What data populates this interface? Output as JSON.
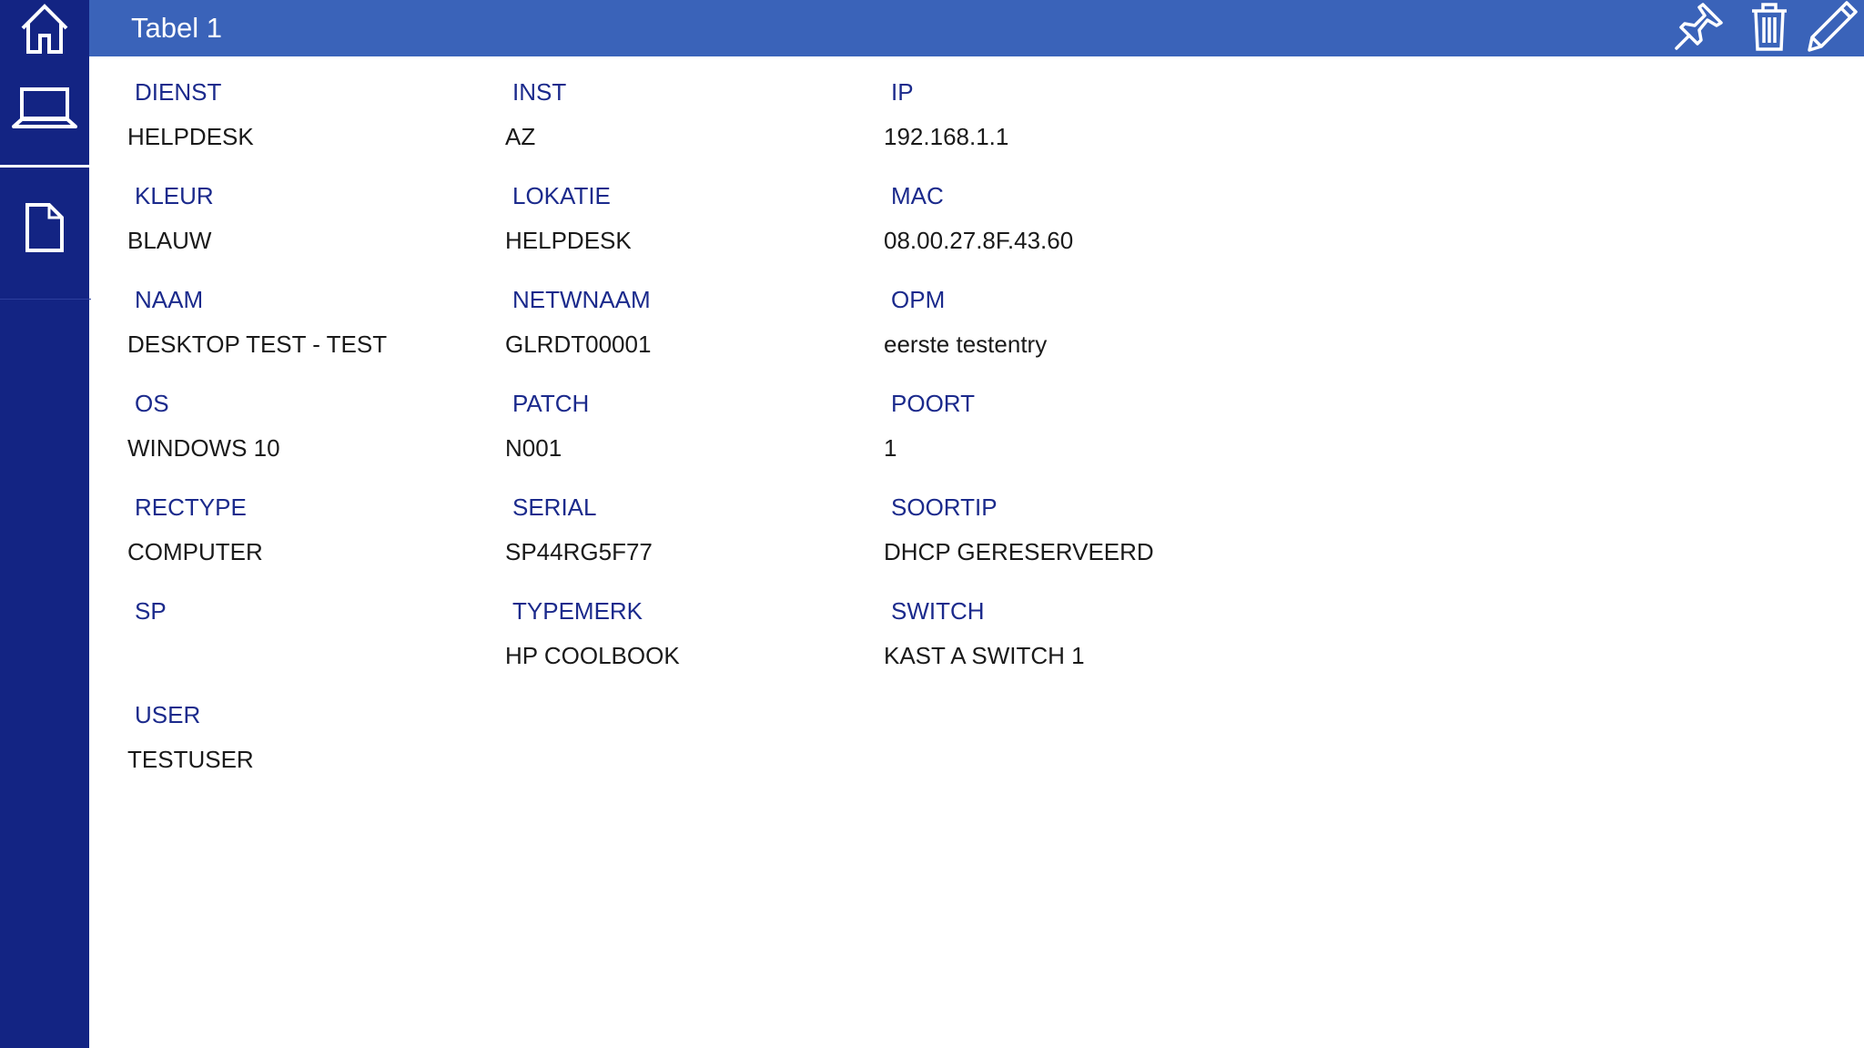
{
  "header": {
    "title": "Tabel 1",
    "background": "#3A63B9",
    "icons": [
      "pin-icon",
      "trash-icon",
      "pencil-icon"
    ]
  },
  "sidebar": {
    "background": "#132483",
    "items": [
      "home-icon",
      "laptop-icon",
      "document-icon"
    ]
  },
  "fields": [
    {
      "label": "DIENST",
      "value": "HELPDESK"
    },
    {
      "label": "INST",
      "value": "AZ"
    },
    {
      "label": "IP",
      "value": "192.168.1.1"
    },
    {
      "label": "KLEUR",
      "value": "BLAUW"
    },
    {
      "label": "LOKATIE",
      "value": "HELPDESK"
    },
    {
      "label": "MAC",
      "value": "08.00.27.8F.43.60"
    },
    {
      "label": "NAAM",
      "value": "DESKTOP TEST - TEST"
    },
    {
      "label": "NETWNAAM",
      "value": "GLRDT00001"
    },
    {
      "label": "OPM",
      "value": "eerste testentry"
    },
    {
      "label": "OS",
      "value": "WINDOWS 10"
    },
    {
      "label": "PATCH",
      "value": "N001"
    },
    {
      "label": "POORT",
      "value": "1"
    },
    {
      "label": "RECTYPE",
      "value": "COMPUTER"
    },
    {
      "label": "SERIAL",
      "value": "SP44RG5F77"
    },
    {
      "label": "SOORTIP",
      "value": "DHCP GERESERVEERD"
    },
    {
      "label": "SP",
      "value": ""
    },
    {
      "label": "TYPEMERK",
      "value": "HP COOLBOOK"
    },
    {
      "label": "SWITCH",
      "value": "KAST A SWITCH 1"
    },
    {
      "label": "USER",
      "value": "TESTUSER"
    }
  ]
}
